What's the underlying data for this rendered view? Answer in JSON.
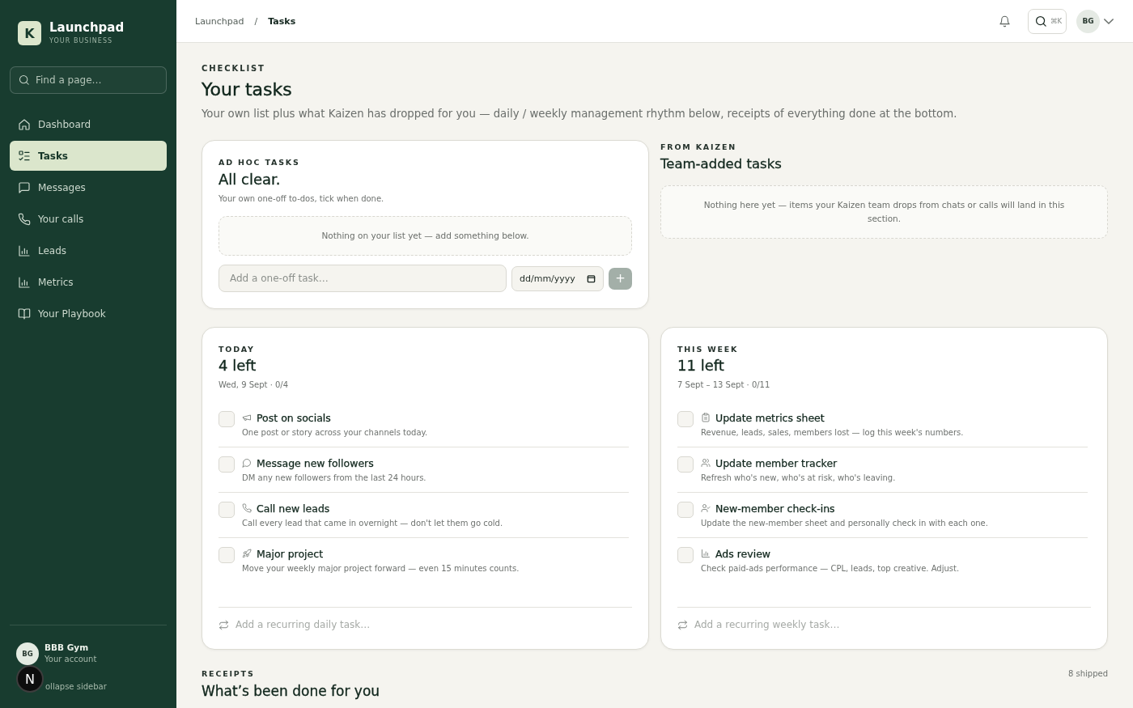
{
  "sidebar": {
    "logo_letter": "K",
    "brand": "Launchpad",
    "tagline": "YOUR BUSINESS",
    "search": {
      "placeholder": "Find a page…"
    },
    "nav": [
      {
        "label": "Dashboard",
        "selected": false
      },
      {
        "label": "Tasks",
        "selected": true
      },
      {
        "label": "Messages",
        "selected": false
      },
      {
        "label": "Your calls",
        "selected": false
      },
      {
        "label": "Leads",
        "selected": false
      },
      {
        "label": "Metrics",
        "selected": false
      },
      {
        "label": "Your Playbook",
        "selected": false
      }
    ],
    "account": {
      "initials": "BG",
      "name": "BBB Gym",
      "subtitle": "Your account"
    },
    "collapse_label": "ollapse sidebar"
  },
  "dev_indicator": {
    "label": "N"
  },
  "header": {
    "breadcrumbs": [
      {
        "label": "Launchpad",
        "current": false
      },
      {
        "label": "Tasks",
        "current": true
      }
    ],
    "separator": "/",
    "search_shortcut": "⌘K",
    "avatar_initials": "BG"
  },
  "page": {
    "eyebrow": "CHECKLIST",
    "title": "Your tasks",
    "subtitle": "Your own list plus what Kaizen has dropped for you — daily / weekly management rhythm below, receipts of everything done at the bottom."
  },
  "ad_hoc": {
    "eyebrow": "AD HOC TASKS",
    "title": "All clear.",
    "subtitle": "Your own one-off to-dos, tick when done.",
    "empty_message": "Nothing on your list yet — add something below.",
    "task_input": {
      "placeholder": "Add a one-off task…"
    },
    "date_input": {
      "placeholder": "dd/mm/yyyy"
    },
    "add_button": {
      "label": "+",
      "disabled": true
    }
  },
  "from_kaizen": {
    "eyebrow": "FROM KAIZEN",
    "title": "Team-added tasks",
    "empty_message": "Nothing here yet — items your Kaizen team drops from chats or calls will land in this section."
  },
  "today": {
    "eyebrow": "TODAY",
    "title": "4 left",
    "meta": "Wed, 9 Sept · 0/4",
    "tasks": [
      {
        "title": "Post on socials",
        "description": "One post or story across your channels today.",
        "checked": false
      },
      {
        "title": "Message new followers",
        "description": "DM any new followers from the last 24 hours.",
        "checked": false
      },
      {
        "title": "Call new leads",
        "description": "Call every lead that came in overnight — don't let them go cold.",
        "checked": false
      },
      {
        "title": "Major project",
        "description": "Move your weekly major project forward — even 15 minutes counts.",
        "checked": false
      }
    ],
    "add_input": {
      "placeholder": "Add a recurring daily task…"
    }
  },
  "this_week": {
    "eyebrow": "THIS WEEK",
    "title": "11 left",
    "meta": "7 Sept – 13 Sept · 0/11",
    "tasks": [
      {
        "title": "Update metrics sheet",
        "description": "Revenue, leads, sales, members lost — log this week's numbers.",
        "checked": false
      },
      {
        "title": "Update member tracker",
        "description": "Refresh who's new, who's at risk, who's leaving.",
        "checked": false
      },
      {
        "title": "New-member check-ins",
        "description": "Update the new-member sheet and personally check in with each one.",
        "checked": false
      },
      {
        "title": "Ads review",
        "description": "Check paid-ads performance — CPL, leads, top creative. Adjust.",
        "checked": false
      }
    ],
    "add_input": {
      "placeholder": "Add a recurring weekly task…"
    }
  },
  "receipts": {
    "eyebrow": "RECEIPTS",
    "title": "What’s been done for you",
    "count": "8 shipped"
  }
}
